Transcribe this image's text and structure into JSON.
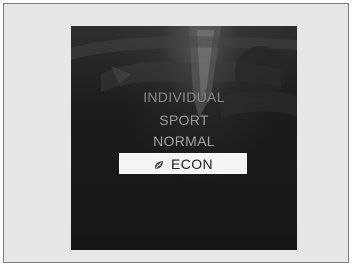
{
  "drive_mode_menu": {
    "options": [
      {
        "label": "INDIVIDUAL",
        "selected": false
      },
      {
        "label": "SPORT",
        "selected": false
      },
      {
        "label": "NORMAL",
        "selected": false
      },
      {
        "label": "ECON",
        "selected": true,
        "icon": "leaf-icon"
      }
    ]
  },
  "colors": {
    "frame_background": "#e7e7e7",
    "screen_background": "#1c1c1c",
    "highlight": "#f4f4f4",
    "highlight_text": "#1e1e1e",
    "menu_text": "#9a9a9a"
  }
}
